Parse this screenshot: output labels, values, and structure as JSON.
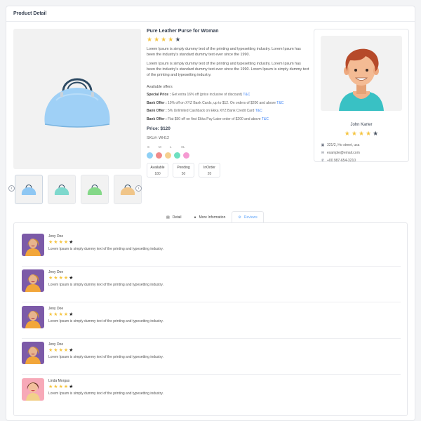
{
  "page_title": "Product Detail",
  "product": {
    "title": "Pure Leather Purse for Woman",
    "rating": 4,
    "rating_max": 5,
    "description_1": "Lorem Ipsum is simply dummy text of the printing and typesetting industry. Lorem Ipsum has been the industry's standard dummy text ever since the 1990.",
    "description_2": "Lorem Ipsum is simply dummy text of the printing and typesetting industry. Lorem Ipsum has been the industry's standard dummy text ever since the 1990. Lorem Ipsum is simply dummy text of the printing and typesetting industry.",
    "offers_title": "Available offers",
    "offers": [
      {
        "label": "Special Price :",
        "text": "Get extra 16% off (price inclusive of discount)",
        "link": "T&C"
      },
      {
        "label": "Bank Offer :",
        "text": "10% off on XYZ Bank Cards, up to $12. On orders of $200 and above",
        "link": "T&C"
      },
      {
        "label": "Bank Offer :",
        "text": "5% Unlimited Cashback on Ekka XYZ Bank Credit Card",
        "link": "T&C"
      },
      {
        "label": "Bank Offer :",
        "text": "Flat $50 off on first Ekka Pay Later order of $200 and above",
        "link": "T&C"
      }
    ],
    "price": "Price: $120",
    "sku": "SKU#: WH12",
    "sizes": [
      "S",
      "M",
      "L",
      "XL"
    ],
    "colors": [
      "#8fd0f5",
      "#f08a8a",
      "#f5d08f",
      "#6ee0c0",
      "#f59ad2"
    ],
    "stock": [
      {
        "label": "Available",
        "value": "180"
      },
      {
        "label": "Pending",
        "value": "50"
      },
      {
        "label": "InOrder",
        "value": "20"
      }
    ],
    "thumbnail_colors": [
      "#8ec7f3",
      "#7ed8cd",
      "#84d888",
      "#f0c589"
    ]
  },
  "seller": {
    "name": "John Karter",
    "rating": 4,
    "address": "321/2, Ho street, usa",
    "email": "example@email.com",
    "phone": "+00 987-654-3210"
  },
  "tabs": [
    {
      "label": "Detail",
      "icon": "doc-icon"
    },
    {
      "label": "More Information",
      "icon": "info-icon"
    },
    {
      "label": "Reviews",
      "icon": "gear-icon"
    }
  ],
  "active_tab": "Reviews",
  "reviews": [
    {
      "name": "Jeny Doe",
      "rating": 4,
      "text": "Lorem Ipsum is simply dummy text of the printing and typesetting industry."
    },
    {
      "name": "Jeny Doe",
      "rating": 4,
      "text": "Lorem Ipsum is simply dummy text of the printing and typesetting industry."
    },
    {
      "name": "Jeny Doe",
      "rating": 4,
      "text": "Lorem Ipsum is simply dummy text of the printing and typesetting industry."
    },
    {
      "name": "Jeny Doe",
      "rating": 4,
      "text": "Lorem Ipsum is simply dummy text of the printing and typesetting industry."
    },
    {
      "name": "Linda Morgus",
      "rating": 4,
      "text": "Lorem Ipsum is simply dummy text of the printing and typesetting industry."
    }
  ]
}
